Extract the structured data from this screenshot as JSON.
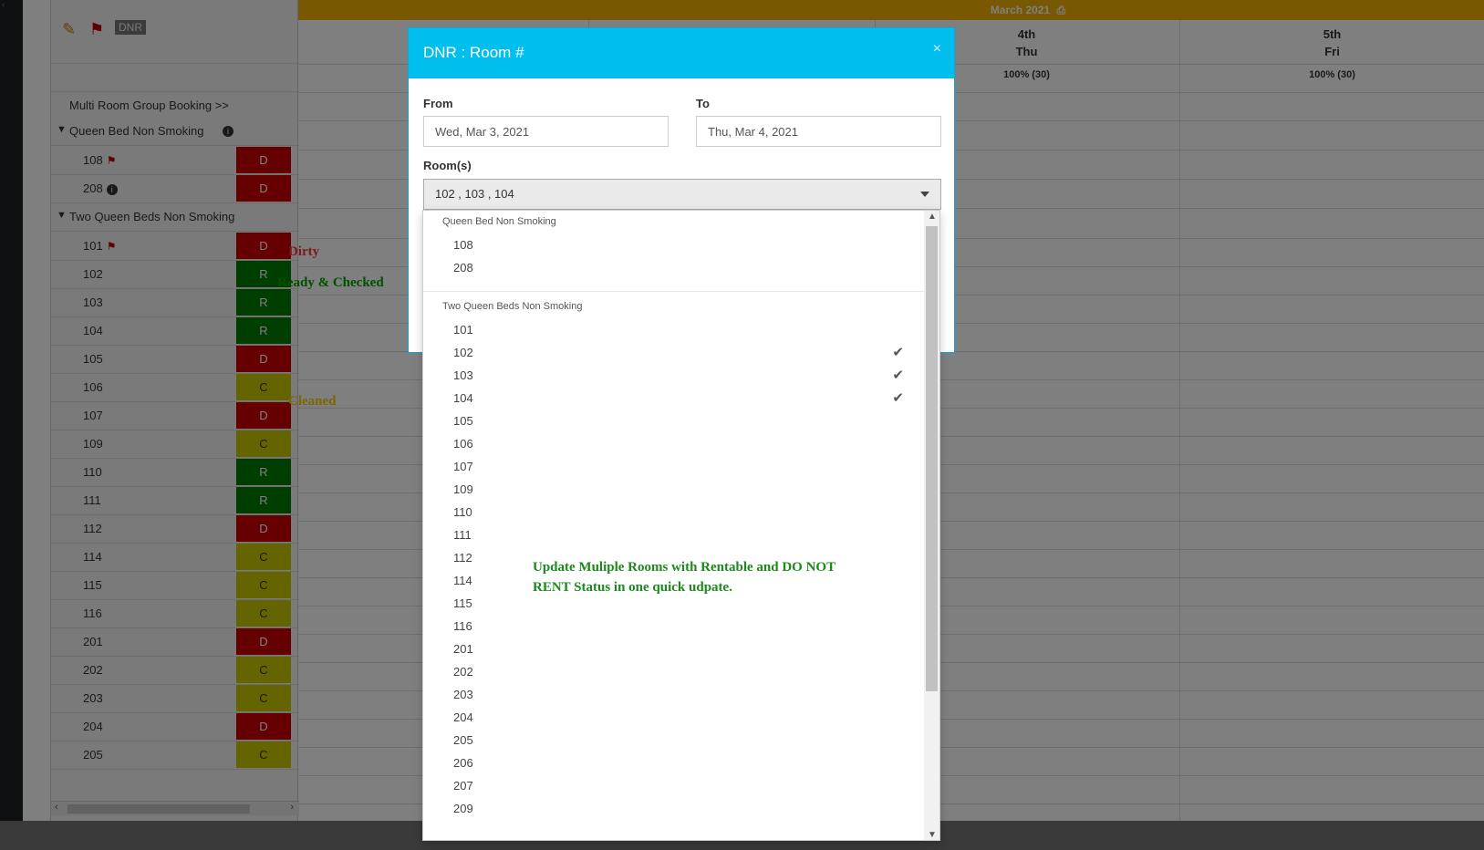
{
  "calendar": {
    "month_label": "March 2021",
    "print_icon": "printer-icon",
    "days": [
      {
        "day": "4th",
        "weekday": "Thu",
        "occupancy": "100% (30)"
      },
      {
        "day": "5th",
        "weekday": "Fri",
        "occupancy": "100% (30)"
      }
    ]
  },
  "sidebar": {
    "toolbar": {
      "broom_icon": "broom-icon",
      "flag_icon": "flag-icon",
      "dnr_label": "DNR"
    },
    "multi_room_link": "Multi Room Group Booking >>",
    "groups": [
      {
        "name": "Queen Bed Non Smoking",
        "rooms": [
          {
            "number": "108",
            "status": "D",
            "flag": true,
            "info": false
          },
          {
            "number": "208",
            "status": "D",
            "flag": false,
            "info": true
          }
        ]
      },
      {
        "name": "Two Queen Beds Non Smoking",
        "rooms": [
          {
            "number": "101",
            "status": "D",
            "flag": true,
            "info": false
          },
          {
            "number": "102",
            "status": "R"
          },
          {
            "number": "103",
            "status": "R"
          },
          {
            "number": "104",
            "status": "R"
          },
          {
            "number": "105",
            "status": "D"
          },
          {
            "number": "106",
            "status": "C"
          },
          {
            "number": "107",
            "status": "D"
          },
          {
            "number": "109",
            "status": "C"
          },
          {
            "number": "110",
            "status": "R"
          },
          {
            "number": "111",
            "status": "R"
          },
          {
            "number": "112",
            "status": "D"
          },
          {
            "number": "114",
            "status": "C"
          },
          {
            "number": "115",
            "status": "C"
          },
          {
            "number": "116",
            "status": "C"
          },
          {
            "number": "201",
            "status": "D"
          },
          {
            "number": "202",
            "status": "C"
          },
          {
            "number": "203",
            "status": "C"
          },
          {
            "number": "204",
            "status": "D"
          },
          {
            "number": "205",
            "status": "C"
          }
        ]
      }
    ]
  },
  "annotations": {
    "dirty": "Dirty",
    "ready": "Ready & Checked",
    "cleaned": "Cleaned"
  },
  "colors": {
    "dirty": "#cc0000",
    "ready": "#007a00",
    "cleaned": "#c9c900",
    "header": "#00bfef",
    "month_bar": "#f0b000"
  },
  "modal": {
    "title": "DNR : Room #",
    "close_label": "×",
    "from_label": "From",
    "from_value": "Wed, Mar 3, 2021",
    "to_label": "To",
    "to_value": "Thu, Mar 4, 2021",
    "rooms_label": "Room(s)",
    "rooms_selected": "102 , 103 , 104"
  },
  "dropdown": {
    "groups": [
      {
        "name": "Queen Bed Non Smoking",
        "items": [
          {
            "number": "108",
            "checked": false
          },
          {
            "number": "208",
            "checked": false
          }
        ]
      },
      {
        "name": "Two Queen Beds Non Smoking",
        "items": [
          {
            "number": "101",
            "checked": false
          },
          {
            "number": "102",
            "checked": true
          },
          {
            "number": "103",
            "checked": true
          },
          {
            "number": "104",
            "checked": true
          },
          {
            "number": "105",
            "checked": false
          },
          {
            "number": "106",
            "checked": false
          },
          {
            "number": "107",
            "checked": false
          },
          {
            "number": "109",
            "checked": false
          },
          {
            "number": "110",
            "checked": false
          },
          {
            "number": "111",
            "checked": false
          },
          {
            "number": "112",
            "checked": false
          },
          {
            "number": "114",
            "checked": false
          },
          {
            "number": "115",
            "checked": false
          },
          {
            "number": "116",
            "checked": false
          },
          {
            "number": "201",
            "checked": false
          },
          {
            "number": "202",
            "checked": false
          },
          {
            "number": "203",
            "checked": false
          },
          {
            "number": "204",
            "checked": false
          },
          {
            "number": "205",
            "checked": false
          },
          {
            "number": "206",
            "checked": false
          },
          {
            "number": "207",
            "checked": false
          },
          {
            "number": "209",
            "checked": false
          }
        ]
      }
    ],
    "check_icon": "check-icon"
  },
  "promo": {
    "text": "Update Muliple Rooms with Rentable and DO NOT RENT Status in one quick udpate."
  }
}
